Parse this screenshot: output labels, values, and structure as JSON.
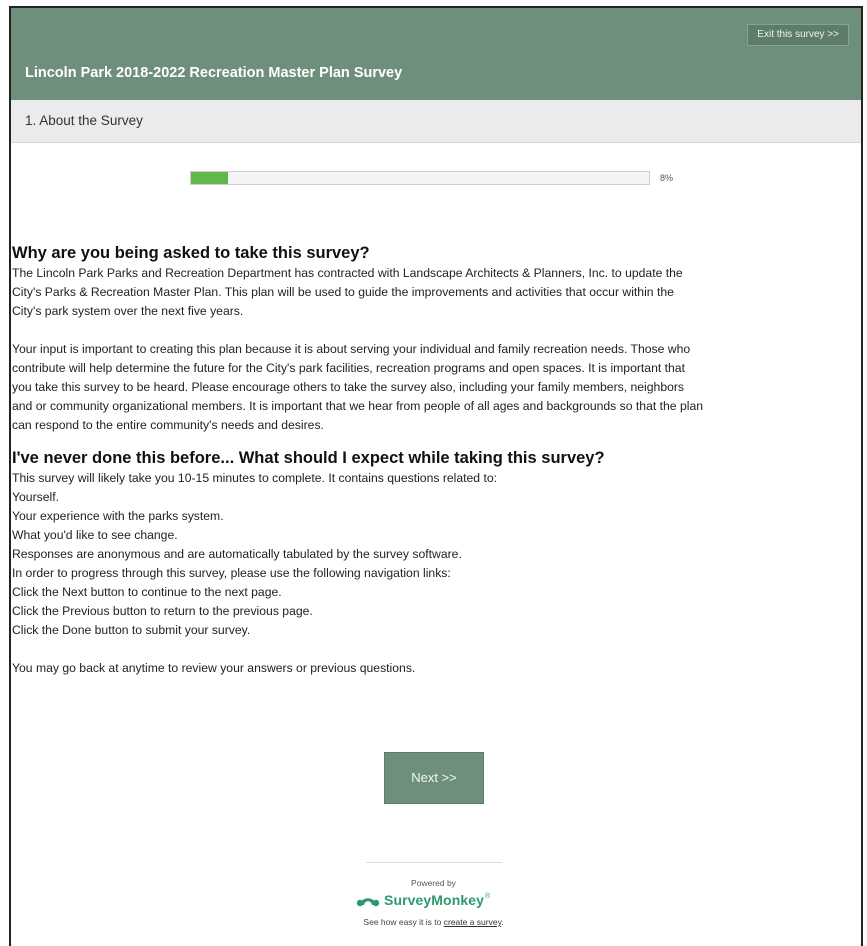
{
  "header": {
    "exit_label": "Exit this survey >>",
    "title": "Lincoln Park 2018-2022 Recreation Master Plan Survey",
    "color": "#6e8f7c"
  },
  "page": {
    "title": "1. About the Survey"
  },
  "progress": {
    "percent": 8,
    "label": "8%",
    "color": "#5fb84a"
  },
  "section1": {
    "heading": "Why are you being asked to take this survey?",
    "p1_lines": [
      "The Lincoln Park Parks and Recreation Department has contracted with Landscape Architects & Planners, Inc. to update the",
      "City's Parks & Recreation Master Plan.  This plan will be used to guide the improvements and activities that occur within the",
      "City's park system over the next five years."
    ],
    "p2_lines": [
      "Your input is important to creating this plan because it is about serving your individual and family recreation needs.  Those who",
      "contribute will help determine the future for the City's park facilities, recreation programs and open spaces.  It is important that",
      "you take this survey to be heard.  Please encourage others to take the survey also, including your family members, neighbors",
      "and or community organizational members.  It is important that we hear from people of all ages and backgrounds so that the plan",
      "can respond to the entire community's needs and desires."
    ]
  },
  "section2": {
    "heading": "I've never done this before... What should I expect while taking this survey?",
    "lines": [
      "This survey will likely take you 10-15 minutes to complete. It contains questions related to:",
      "Yourself.",
      "Your experience with the parks system.",
      "What you'd like to see change.",
      "Responses are anonymous and are automatically tabulated by the survey software.",
      "In order to progress through this survey, please use the following navigation links:",
      "Click the Next button to continue to the next page.",
      "Click the Previous button to return to the previous page.",
      "Click the Done button to submit your survey."
    ],
    "closing": "You may go back at anytime to review your answers or previous questions."
  },
  "next_label": "Next >>",
  "footer": {
    "powered_by": "Powered by",
    "brand": "SurveyMonkey",
    "brand_mark": "®",
    "tagline_prefix": "See how easy it is to ",
    "tagline_link": "create a survey",
    "tagline_suffix": ".",
    "brand_color": "#2c9a6c"
  }
}
